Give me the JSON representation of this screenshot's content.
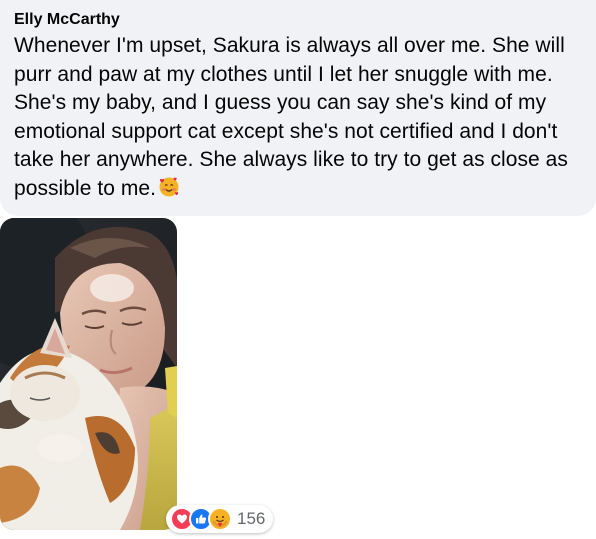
{
  "comment": {
    "author": "Elly McCarthy",
    "text": "Whenever I'm upset, Sakura is always all over me. She will purr and paw at my clothes until I let her snuggle with me. She's my baby, and I guess you can say she's kind of my emotional support cat except she's not certified and I don't take her anywhere. She always like to try to get as close as possible to me.",
    "inline_emoji": "smiling-face-with-hearts-emoji"
  },
  "photo": {
    "subject": "woman-with-cat-photo"
  },
  "reactions": {
    "icons": [
      "love-icon",
      "like-icon",
      "care-icon"
    ],
    "count": "156",
    "colors": {
      "love": "#f33e58",
      "like": "#1877f2",
      "care": "#f7b125"
    }
  },
  "colors": {
    "bubble_bg": "#f0f2f5",
    "text": "#050505",
    "secondary_text": "#65676b"
  }
}
